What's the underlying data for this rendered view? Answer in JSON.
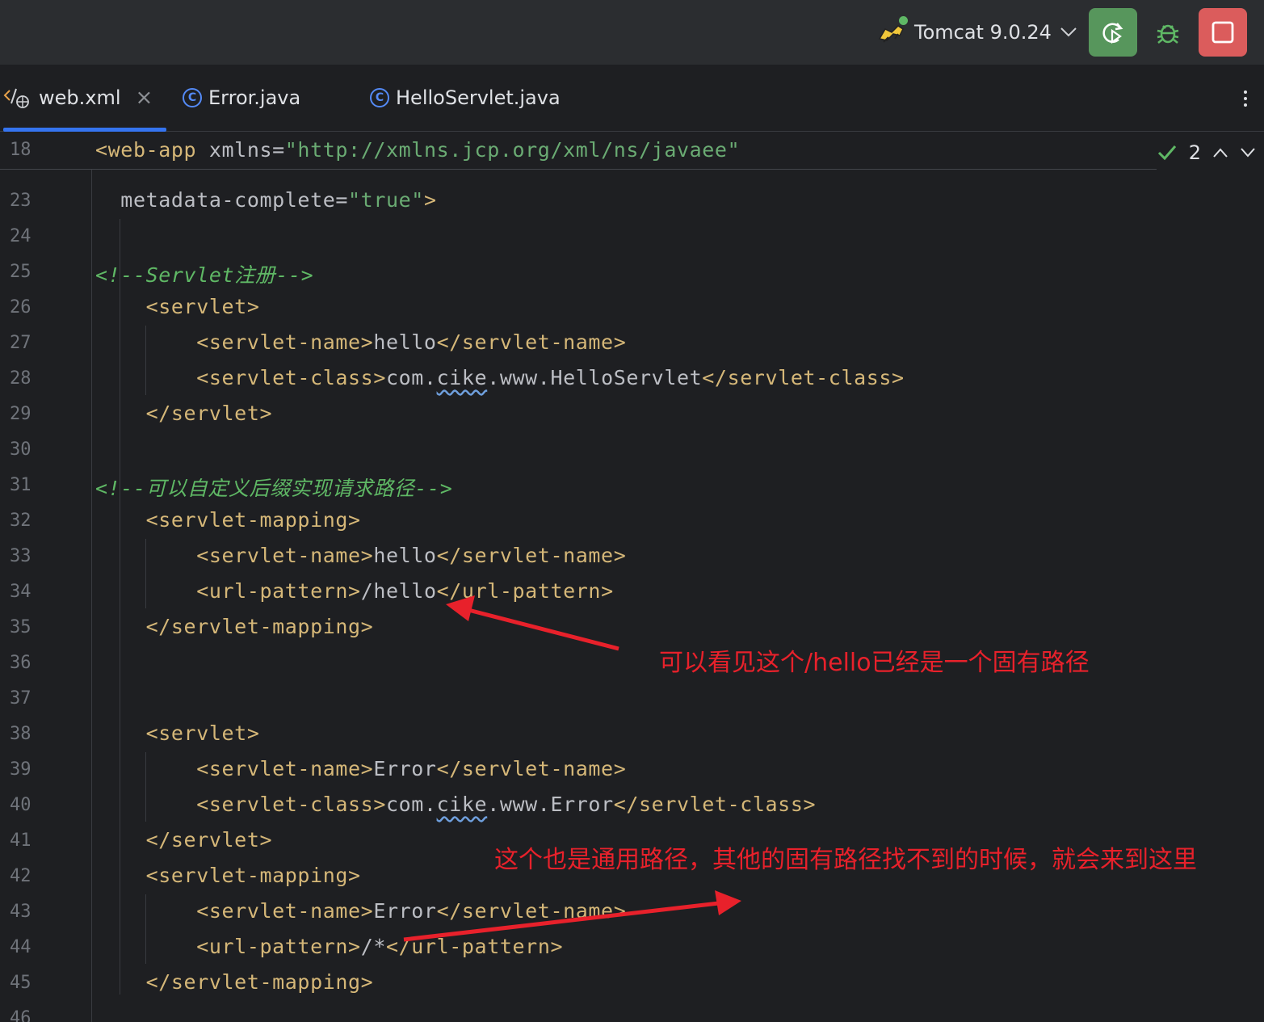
{
  "toolbar": {
    "run_config": "Tomcat 9.0.24",
    "colors": {
      "rerun": "#57965c",
      "stop": "#db5c5c",
      "debug": "#5fb865"
    }
  },
  "tabs": [
    {
      "label": "web.xml",
      "icon": "xml-web-icon",
      "active": true
    },
    {
      "label": "Error.java",
      "icon": "class-icon",
      "active": false
    },
    {
      "label": "HelloServlet.java",
      "icon": "class-icon",
      "active": false
    }
  ],
  "inspection": {
    "count": "2"
  },
  "sticky": {
    "line": "18",
    "tag": "<web-app",
    "attr": " xmlns=",
    "value": "\"http://xmlns.jcp.org/xml/ns/javaee\""
  },
  "lines": [
    {
      "n": "23",
      "t1": "  metadata-complete=",
      "t2": "\"true\"",
      "t3": ">"
    },
    {
      "n": "24"
    },
    {
      "n": "25",
      "comment": "<!--Servlet注册-->"
    },
    {
      "n": "26",
      "code": "    <servlet>"
    },
    {
      "n": "27",
      "a": "        <servlet-name>",
      "b": "hello",
      "c": "</servlet-name>"
    },
    {
      "n": "28",
      "a": "        <servlet-class>",
      "b1": "com.",
      "sq": "cike",
      "b2": ".www.HelloServlet",
      "c": "</servlet-class>"
    },
    {
      "n": "29",
      "code": "    </servlet>"
    },
    {
      "n": "30"
    },
    {
      "n": "31",
      "comment": "<!--可以自定义后缀实现请求路径-->"
    },
    {
      "n": "32",
      "code": "    <servlet-mapping>"
    },
    {
      "n": "33",
      "a": "        <servlet-name>",
      "b": "hello",
      "c": "</servlet-name>"
    },
    {
      "n": "34",
      "a": "        <url-pattern>",
      "b": "/hello",
      "c": "</url-pattern>"
    },
    {
      "n": "35",
      "code": "    </servlet-mapping>"
    },
    {
      "n": "36"
    },
    {
      "n": "37"
    },
    {
      "n": "38",
      "code": "    <servlet>"
    },
    {
      "n": "39",
      "a": "        <servlet-name>",
      "b": "Error",
      "c": "</servlet-name>"
    },
    {
      "n": "40",
      "a": "        <servlet-class>",
      "b1": "com.",
      "sq": "cike",
      "b2": ".www.Error",
      "c": "</servlet-class>"
    },
    {
      "n": "41",
      "code": "    </servlet>"
    },
    {
      "n": "42",
      "code": "    <servlet-mapping>"
    },
    {
      "n": "43",
      "a": "        <servlet-name>",
      "b": "Error",
      "c": "</servlet-name>"
    },
    {
      "n": "44",
      "a": "        <url-pattern>",
      "b": "/*",
      "c": "</url-pattern>"
    },
    {
      "n": "45",
      "code": "    </servlet-mapping>"
    },
    {
      "n": "46"
    }
  ],
  "annotations": {
    "note1": "可以看见这个/hello已经是一个固有路径",
    "note2": "这个也是通用路径，其他的固有路径找不到的时候，就会来到这里",
    "color": "#e8212b"
  }
}
